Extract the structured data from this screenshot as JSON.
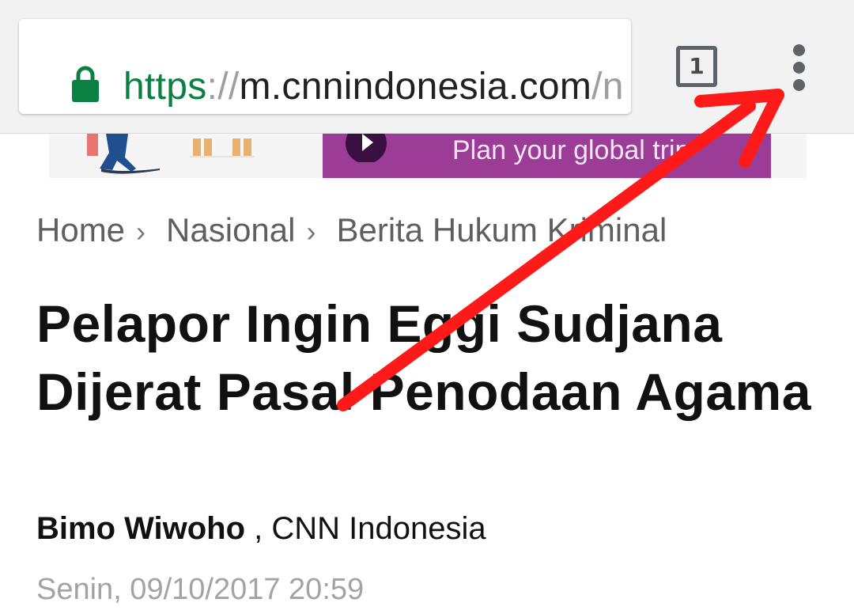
{
  "browser": {
    "url": {
      "scheme": "https",
      "separator": "://",
      "host": "m.cnnindonesia.com",
      "path": "/n"
    },
    "tab_count": "1",
    "icons": {
      "lock": "lock-icon",
      "menu": "overflow-menu-icon"
    },
    "colors": {
      "secure_scheme": "#0b8043",
      "toolbar_bg": "#f2f2f2"
    }
  },
  "ad": {
    "cta_text": "Plan your global trip",
    "cta_color": "#9b3d96"
  },
  "breadcrumb": {
    "items": [
      "Home",
      "Nasional",
      "Berita Hukum Kriminal"
    ],
    "separator": "›"
  },
  "article": {
    "title": "Pelapor Ingin Eggi Sudjana Dijerat Pasal Penodaan Agama",
    "author": "Bimo Wiwoho",
    "byline_separator": " , ",
    "source": "CNN Indonesia",
    "timestamp": "Senin, 09/10/2017 20:59"
  },
  "annotation": {
    "type": "arrow",
    "color": "#ff1a1a",
    "points_to": "overflow-menu-icon"
  }
}
